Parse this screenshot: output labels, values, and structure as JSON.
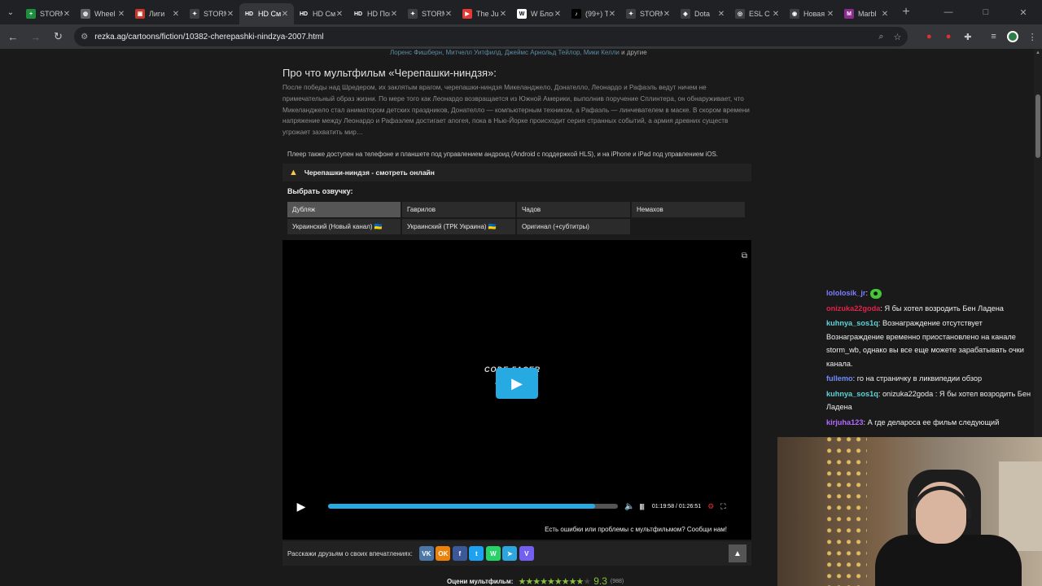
{
  "tabs": [
    {
      "title": "STORM",
      "fav_color": "#1e8e3e",
      "fav_text": "+"
    },
    {
      "title": "Wheel",
      "fav_color": "#5f6368",
      "fav_text": "◍"
    },
    {
      "title": "Лиги",
      "fav_color": "#c0392b",
      "fav_text": "▣"
    },
    {
      "title": "STORM",
      "fav_color": "#3c4043",
      "fav_text": "✦"
    },
    {
      "title": "HD Смотр",
      "fav_color": "#35363a",
      "fav_text": "HD",
      "active": true
    },
    {
      "title": "HD Смотр",
      "fav_color": "#202124",
      "fav_text": "HD"
    },
    {
      "title": "HD Поиск",
      "fav_color": "#202124",
      "fav_text": "HD"
    },
    {
      "title": "STORM",
      "fav_color": "#3c4043",
      "fav_text": "✦"
    },
    {
      "title": "The Ju",
      "fav_color": "#e53935",
      "fav_text": "▶"
    },
    {
      "title": "W Блонд",
      "fav_color": "#fff",
      "fav_text": "W"
    },
    {
      "title": "(99+) T",
      "fav_color": "#000",
      "fav_text": "♪"
    },
    {
      "title": "STORM",
      "fav_color": "#3c4043",
      "fav_text": "✦"
    },
    {
      "title": "Dota",
      "fav_color": "#3c4043",
      "fav_text": "◈"
    },
    {
      "title": "ESL C",
      "fav_color": "#3c4043",
      "fav_text": "◎"
    },
    {
      "title": "Новая",
      "fav_color": "#3c4043",
      "fav_text": "◉"
    },
    {
      "title": "Marbl",
      "fav_color": "#8e2b8e",
      "fav_text": "M"
    }
  ],
  "toolbar": {
    "url": "rezka.ag/cartoons/fiction/10382-cherepashki-nindzya-2007.html"
  },
  "page": {
    "cast_links": "Лоренс Фишберн, Митчелл Уитфилд, Джеймс Арнольд Тейлор, Мики Келли",
    "cast_tail": "и другие",
    "about_title": "Про что мультфильм «Черепашки-ниндзя»:",
    "about_text": "После победы над Шредером, их заклятым врагом, черепашки-ниндзя Микеланджело, Донателло, Леонардо и Рафаэль ведут ничем не примечательный образ жизни. По мере того как Леонардо возвращается из Южной Америки, выполнив поручение Сплинтера, он обнаруживает, что Микеланджело стал аниматором детских праздников, Донателло — компьютерным техником, а Рафаэль — линчевателем в маске. В скором времени напряжение между Леонардо и Рафаэлем достигает апогея, пока в Нью-Йорке происходит серия странных событий, а армия древних существ угрожает захватить мир…",
    "player_note": "Плеер также доступен на телефоне и планшете под управлением андроид (Android с поддержкой HLS), и на iPhone и iPad под управлением iOS.",
    "warn_text": "Черепашки-ниндзя - смотреть онлайн",
    "voice_title": "Выбрать озвучку:",
    "voices": [
      "Дубляж",
      "Гаврилов",
      "Чадов",
      "Немахов",
      "Украинский (Новый канал) 🇺🇦",
      "Украинский (ТРК Украина) 🇺🇦",
      "Оригинал (+субтитры)"
    ],
    "player": {
      "logo_line1": "CODE FACER",
      "logo_line2": "FLIP",
      "progress_fraction": 0.92,
      "time": "01:19:58 / 01:26:51"
    },
    "report": "Есть ошибки или проблемы с мультфильмом? Сообщи нам!",
    "share_label": "Расскажи друзьям о своих впечатлениях:",
    "socials": [
      {
        "label": "VK",
        "color": "#4a76a8"
      },
      {
        "label": "OK",
        "color": "#ee8208"
      },
      {
        "label": "f",
        "color": "#3b5998"
      },
      {
        "label": "t",
        "color": "#1da1f2"
      },
      {
        "label": "W",
        "color": "#25d366"
      },
      {
        "label": "➤",
        "color": "#2ca5e0"
      },
      {
        "label": "V",
        "color": "#7360f2"
      }
    ],
    "rating_label": "Оцени мультфильм:",
    "rating_value": "9.3",
    "rating_count": "(988)",
    "rating_stars_on": 9,
    "rating_stars_total": 10
  },
  "chat": [
    {
      "user": "lololosik_jr",
      "color": "#7d7dff",
      "text": "",
      "emote": true
    },
    {
      "user": "onizuka22goda",
      "color": "#e0224a",
      "text": "Я бы хотел возродить Бен Ладена"
    },
    {
      "user": "kuhnya_sos1q",
      "color": "#5fd3d8",
      "text": "Вознаграждение отсутствует Вознаграждение временно приостановлено на канале storm_wb, однако вы все еще можете зарабатывать очки канала."
    },
    {
      "user": "fullemo",
      "color": "#6f8cff",
      "text": "го на страничку в ликвипедии обзор"
    },
    {
      "user": "kuhnya_sos1q",
      "color": "#5fd3d8",
      "text": "onizuka22goda : Я бы хотел возродить Бен Ладена"
    },
    {
      "user": "kirjuha123",
      "color": "#b36bff",
      "text": "А где делароса ее фильм следующий"
    }
  ]
}
